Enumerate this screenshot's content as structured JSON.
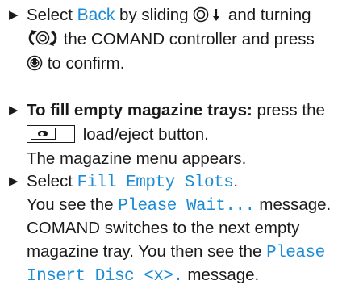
{
  "steps": [
    {
      "lines": [
        {
          "pre": "Select ",
          "display": "Back",
          "post": " by sliding"
        },
        {
          "post": " the COMAND controller and press"
        },
        {
          "post": " to confirm."
        }
      ]
    },
    {
      "lines": [
        {
          "bold": "To fill empty magazine trays:",
          "post": " press the"
        },
        {
          "post": " load/eject button."
        },
        {
          "post": "The magazine menu appears."
        }
      ]
    },
    {
      "lines": [
        {
          "pre": "Select ",
          "display": "Fill Empty Slots",
          "post": "."
        },
        {
          "pre": "You see the ",
          "display": "Please Wait...",
          "post": " message."
        },
        {
          "post": "COMAND switches to the next empty"
        },
        {
          "pre": "magazine tray. You then see the ",
          "display": "Please"
        },
        {
          "display": "Insert Disc <x>.",
          "post": " message."
        }
      ]
    }
  ],
  "icons": {
    "slide": "controller-slide-down-icon",
    "turn": "controller-turn-icon",
    "press": "controller-press-icon",
    "eject": "load-eject-button-icon",
    "bullet": "▶"
  },
  "colors": {
    "display_text": "#1b8bd6",
    "body_text": "#1a1a1a"
  }
}
